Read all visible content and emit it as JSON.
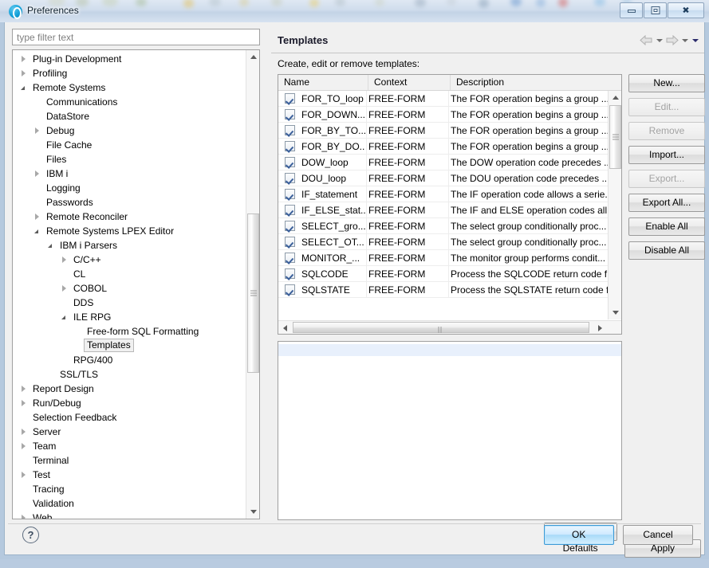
{
  "window": {
    "title": "Preferences",
    "icon": "eclipse-icon",
    "buttons": {
      "minimize": "minimize-icon",
      "restore": "restore-icon",
      "close": "close-icon"
    }
  },
  "filter": {
    "placeholder": "type filter text",
    "value": ""
  },
  "tree": {
    "items": [
      {
        "label": "Plug-in Development",
        "depth": 0,
        "state": "collapsed",
        "selected": false
      },
      {
        "label": "Profiling",
        "depth": 0,
        "state": "collapsed",
        "selected": false
      },
      {
        "label": "Remote Systems",
        "depth": 0,
        "state": "expanded",
        "selected": false
      },
      {
        "label": "Communications",
        "depth": 1,
        "state": "leaf",
        "selected": false
      },
      {
        "label": "DataStore",
        "depth": 1,
        "state": "leaf",
        "selected": false
      },
      {
        "label": "Debug",
        "depth": 1,
        "state": "collapsed",
        "selected": false
      },
      {
        "label": "File Cache",
        "depth": 1,
        "state": "leaf",
        "selected": false
      },
      {
        "label": "Files",
        "depth": 1,
        "state": "leaf",
        "selected": false
      },
      {
        "label": "IBM i",
        "depth": 1,
        "state": "collapsed",
        "selected": false
      },
      {
        "label": "Logging",
        "depth": 1,
        "state": "leaf",
        "selected": false
      },
      {
        "label": "Passwords",
        "depth": 1,
        "state": "leaf",
        "selected": false
      },
      {
        "label": "Remote Reconciler",
        "depth": 1,
        "state": "collapsed",
        "selected": false
      },
      {
        "label": "Remote Systems LPEX Editor",
        "depth": 1,
        "state": "expanded",
        "selected": false
      },
      {
        "label": "IBM i Parsers",
        "depth": 2,
        "state": "expanded",
        "selected": false
      },
      {
        "label": "C/C++",
        "depth": 3,
        "state": "collapsed",
        "selected": false
      },
      {
        "label": "CL",
        "depth": 3,
        "state": "leaf",
        "selected": false
      },
      {
        "label": "COBOL",
        "depth": 3,
        "state": "collapsed",
        "selected": false
      },
      {
        "label": "DDS",
        "depth": 3,
        "state": "leaf",
        "selected": false
      },
      {
        "label": "ILE RPG",
        "depth": 3,
        "state": "expanded",
        "selected": false
      },
      {
        "label": "Free-form SQL Formatting",
        "depth": 4,
        "state": "leaf",
        "selected": false
      },
      {
        "label": "Templates",
        "depth": 4,
        "state": "leaf",
        "selected": true
      },
      {
        "label": "RPG/400",
        "depth": 3,
        "state": "leaf",
        "selected": false
      },
      {
        "label": "SSL/TLS",
        "depth": 2,
        "state": "leaf",
        "selected": false
      },
      {
        "label": "Report Design",
        "depth": 0,
        "state": "collapsed",
        "selected": false
      },
      {
        "label": "Run/Debug",
        "depth": 0,
        "state": "collapsed",
        "selected": false
      },
      {
        "label": "Selection Feedback",
        "depth": 0,
        "state": "leaf",
        "selected": false
      },
      {
        "label": "Server",
        "depth": 0,
        "state": "collapsed",
        "selected": false
      },
      {
        "label": "Team",
        "depth": 0,
        "state": "collapsed",
        "selected": false
      },
      {
        "label": "Terminal",
        "depth": 0,
        "state": "leaf",
        "selected": false
      },
      {
        "label": "Test",
        "depth": 0,
        "state": "collapsed",
        "selected": false
      },
      {
        "label": "Tracing",
        "depth": 0,
        "state": "leaf",
        "selected": false
      },
      {
        "label": "Validation",
        "depth": 0,
        "state": "leaf",
        "selected": false
      },
      {
        "label": "Web",
        "depth": 0,
        "state": "collapsed",
        "selected": false
      }
    ]
  },
  "page": {
    "title": "Templates",
    "description_label": "Create, edit or remove templates:",
    "nav": {
      "back": "back-arrow-icon",
      "back_menu": "chevron-down-icon",
      "forward": "forward-arrow-icon",
      "forward_menu": "chevron-down-icon",
      "view_menu": "chevron-down-icon"
    }
  },
  "table": {
    "columns": [
      "Name",
      "Context",
      "Description"
    ],
    "rows": [
      {
        "checked": true,
        "name": "FOR_TO_loop",
        "context": "FREE-FORM",
        "description": "The FOR operation begins a group ..."
      },
      {
        "checked": true,
        "name": "FOR_DOWN...",
        "context": "FREE-FORM",
        "description": "The FOR operation begins a group ..."
      },
      {
        "checked": true,
        "name": "FOR_BY_TO...",
        "context": "FREE-FORM",
        "description": "The FOR operation begins a group ..."
      },
      {
        "checked": true,
        "name": "FOR_BY_DO...",
        "context": "FREE-FORM",
        "description": "The FOR operation begins a group ..."
      },
      {
        "checked": true,
        "name": "DOW_loop",
        "context": "FREE-FORM",
        "description": "The DOW operation code precedes ..."
      },
      {
        "checked": true,
        "name": "DOU_loop",
        "context": "FREE-FORM",
        "description": "The DOU operation code precedes ..."
      },
      {
        "checked": true,
        "name": "IF_statement",
        "context": "FREE-FORM",
        "description": "The IF operation code allows a serie..."
      },
      {
        "checked": true,
        "name": "IF_ELSE_stat...",
        "context": "FREE-FORM",
        "description": "The IF and ELSE operation codes all..."
      },
      {
        "checked": true,
        "name": "SELECT_gro...",
        "context": "FREE-FORM",
        "description": "The select group conditionally proc..."
      },
      {
        "checked": true,
        "name": "SELECT_OT...",
        "context": "FREE-FORM",
        "description": "The select group conditionally proc..."
      },
      {
        "checked": true,
        "name": "MONITOR_...",
        "context": "FREE-FORM",
        "description": "The monitor group performs condit..."
      },
      {
        "checked": true,
        "name": "SQLCODE",
        "context": "FREE-FORM",
        "description": "Process the SQLCODE return code f..."
      },
      {
        "checked": true,
        "name": "SQLSTATE",
        "context": "FREE-FORM",
        "description": "Process the SQLSTATE return code f..."
      }
    ]
  },
  "side_buttons": [
    {
      "label": "New...",
      "enabled": true
    },
    {
      "label": "Edit...",
      "enabled": false
    },
    {
      "label": "Remove",
      "enabled": false
    },
    {
      "label": "Import...",
      "enabled": true
    },
    {
      "label": "Export...",
      "enabled": false
    },
    {
      "label": "Export All...",
      "enabled": true
    },
    {
      "label": "Enable All",
      "enabled": true
    },
    {
      "label": "Disable All",
      "enabled": true
    }
  ],
  "page_buttons": {
    "restore_defaults": "Restore Defaults",
    "apply": "Apply"
  },
  "footer": {
    "help": "?",
    "ok": "OK",
    "cancel": "Cancel"
  },
  "colors": {
    "accent": "#3c9ad6",
    "window_bg": "#f0f0f0",
    "title_bar": "#cfdcec",
    "preview_highlight": "#e8f0fc",
    "checkbox_check": "#3a5f9a"
  }
}
